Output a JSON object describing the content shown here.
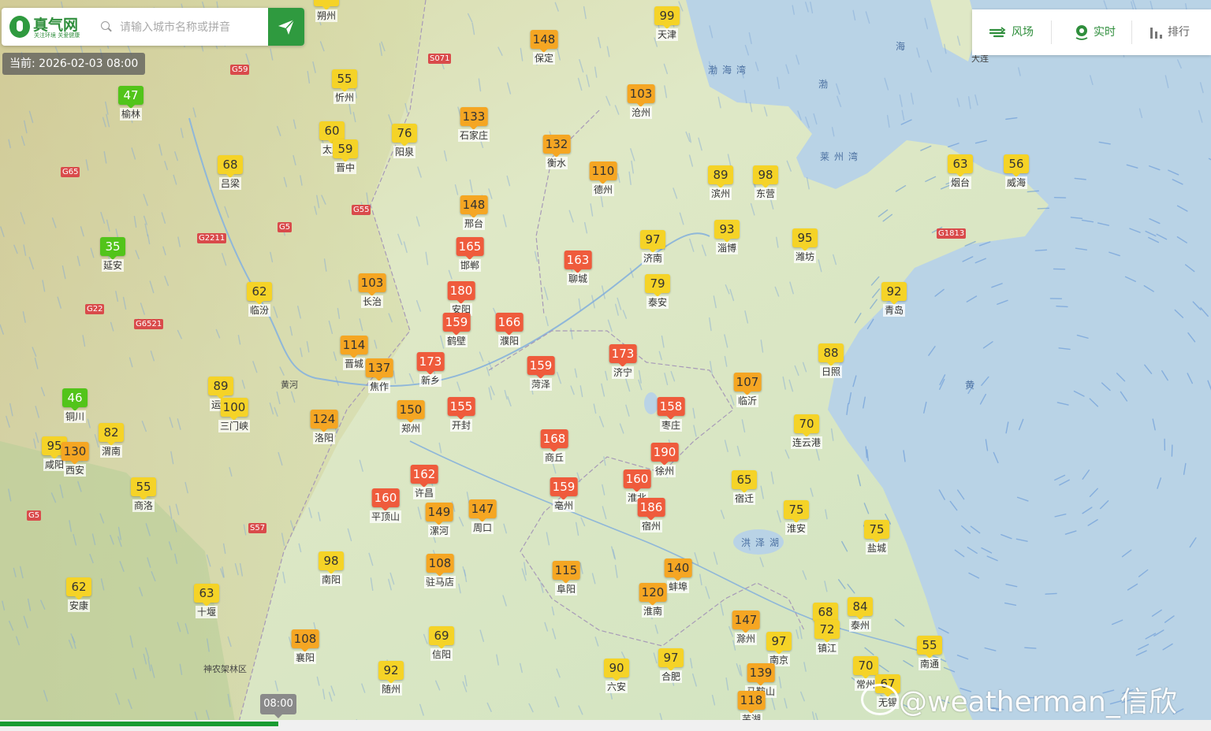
{
  "search": {
    "placeholder": "请输入城市名称或拼音"
  },
  "logo": {
    "name": "真气网",
    "tagline": "关注环境 关爱健康"
  },
  "current_time": "当前: 2026-02-03 08:00",
  "toolbar": [
    {
      "label": "风场",
      "icon": "wind-icon"
    },
    {
      "label": "实时",
      "icon": "location-pin-icon"
    },
    {
      "label": "排行",
      "icon": "bar-chart-icon"
    }
  ],
  "timeline": {
    "current_label": "08:00",
    "progress_fraction": 0.23
  },
  "watermark": "@weatherman_信欣",
  "aqi_levels": {
    "good": "#52c41a",
    "moderate": "#f5d327",
    "lightly_polluted": "#f5a623",
    "moderately_polluted": "#ef5b3c"
  },
  "cities": [
    {
      "name": "朔州",
      "aqi": ""
    },
    {
      "name": "天津",
      "aqi": 99
    },
    {
      "name": "保定",
      "aqi": 148
    },
    {
      "name": "忻州",
      "aqi": 55
    },
    {
      "name": "榆林",
      "aqi": 47
    },
    {
      "name": "沧州",
      "aqi": 103
    },
    {
      "name": "石家庄",
      "aqi": 133
    },
    {
      "name": "太原",
      "aqi": 60
    },
    {
      "name": "晋中",
      "aqi": 59
    },
    {
      "name": "阳泉",
      "aqi": 76
    },
    {
      "name": "衡水",
      "aqi": 132
    },
    {
      "name": "吕梁",
      "aqi": 68
    },
    {
      "name": "德州",
      "aqi": 110
    },
    {
      "name": "滨州",
      "aqi": 89
    },
    {
      "name": "东营",
      "aqi": 98
    },
    {
      "name": "烟台",
      "aqi": 63
    },
    {
      "name": "威海",
      "aqi": 56
    },
    {
      "name": "邢台",
      "aqi": 148
    },
    {
      "name": "淄博",
      "aqi": 93
    },
    {
      "name": "潍坊",
      "aqi": 95
    },
    {
      "name": "济南",
      "aqi": 97
    },
    {
      "name": "延安",
      "aqi": 35
    },
    {
      "name": "邯郸",
      "aqi": 165
    },
    {
      "name": "聊城",
      "aqi": 163
    },
    {
      "name": "长治",
      "aqi": 103
    },
    {
      "name": "临汾",
      "aqi": 62
    },
    {
      "name": "泰安",
      "aqi": 79
    },
    {
      "name": "青岛",
      "aqi": 92
    },
    {
      "name": "安阳",
      "aqi": 180
    },
    {
      "name": "鹤壁",
      "aqi": 159
    },
    {
      "name": "濮阳",
      "aqi": 166
    },
    {
      "name": "晋城",
      "aqi": 114
    },
    {
      "name": "焦作",
      "aqi": 137
    },
    {
      "name": "新乡",
      "aqi": 173
    },
    {
      "name": "菏泽",
      "aqi": 159
    },
    {
      "name": "济宁",
      "aqi": 173
    },
    {
      "name": "日照",
      "aqi": 88
    },
    {
      "name": "临沂",
      "aqi": 107
    },
    {
      "name": "铜川",
      "aqi": 46
    },
    {
      "name": "运城",
      "aqi": 89
    },
    {
      "name": "三门峡",
      "aqi": 100
    },
    {
      "name": "郑州",
      "aqi": 150
    },
    {
      "name": "开封",
      "aqi": 155
    },
    {
      "name": "枣庄",
      "aqi": 158
    },
    {
      "name": "洛阳",
      "aqi": 124
    },
    {
      "name": "渭南",
      "aqi": 82
    },
    {
      "name": "咸阳",
      "aqi": 95
    },
    {
      "name": "西安",
      "aqi": 130
    },
    {
      "name": "商丘",
      "aqi": 168
    },
    {
      "name": "连云港",
      "aqi": 70
    },
    {
      "name": "徐州",
      "aqi": 190
    },
    {
      "name": "许昌",
      "aqi": 162
    },
    {
      "name": "宿迁",
      "aqi": 65
    },
    {
      "name": "商洛",
      "aqi": 55
    },
    {
      "name": "平顶山",
      "aqi": 160
    },
    {
      "name": "亳州",
      "aqi": 159
    },
    {
      "name": "淮北",
      "aqi": 160
    },
    {
      "name": "周口",
      "aqi": 147
    },
    {
      "name": "漯河",
      "aqi": 149
    },
    {
      "name": "淮安",
      "aqi": 75
    },
    {
      "name": "宿州",
      "aqi": 186
    },
    {
      "name": "盐城",
      "aqi": 75
    },
    {
      "name": "南阳",
      "aqi": 98
    },
    {
      "name": "驻马店",
      "aqi": 108
    },
    {
      "name": "阜阳",
      "aqi": 115
    },
    {
      "name": "蚌埠",
      "aqi": 140
    },
    {
      "name": "安康",
      "aqi": 62
    },
    {
      "name": "十堰",
      "aqi": 63
    },
    {
      "name": "淮南",
      "aqi": 120
    },
    {
      "name": "扬州",
      "aqi": 68
    },
    {
      "name": "泰州",
      "aqi": 84
    },
    {
      "name": "滁州",
      "aqi": 147
    },
    {
      "name": "镇江",
      "aqi": 72
    },
    {
      "name": "襄阳",
      "aqi": 108
    },
    {
      "name": "信阳",
      "aqi": 69
    },
    {
      "name": "南京",
      "aqi": 97
    },
    {
      "name": "南通",
      "aqi": 55
    },
    {
      "name": "合肥",
      "aqi": 97
    },
    {
      "name": "常州",
      "aqi": 70
    },
    {
      "name": "六安",
      "aqi": 90
    },
    {
      "name": "马鞍山",
      "aqi": 139
    },
    {
      "name": "随州",
      "aqi": 92
    },
    {
      "name": "芜湖",
      "aqi": 118
    },
    {
      "name": "无锡",
      "aqi": 67
    }
  ],
  "map_labels": [
    {
      "text": "渤海湾",
      "kind": "sea"
    },
    {
      "text": "莱州湾",
      "kind": "sea"
    },
    {
      "text": "海",
      "kind": "sea"
    },
    {
      "text": "渤",
      "kind": "sea"
    },
    {
      "text": "黄",
      "kind": "sea"
    },
    {
      "text": "洪泽湖",
      "kind": "lake"
    },
    {
      "text": "神农架林区",
      "kind": "place"
    },
    {
      "text": "黄河",
      "kind": "river"
    },
    {
      "text": "大连",
      "kind": "place"
    }
  ],
  "road_signs": [
    "G59",
    "G65",
    "G55",
    "G5",
    "G22",
    "G6521",
    "G5",
    "S57",
    "G1813",
    "S071",
    "G2211"
  ]
}
